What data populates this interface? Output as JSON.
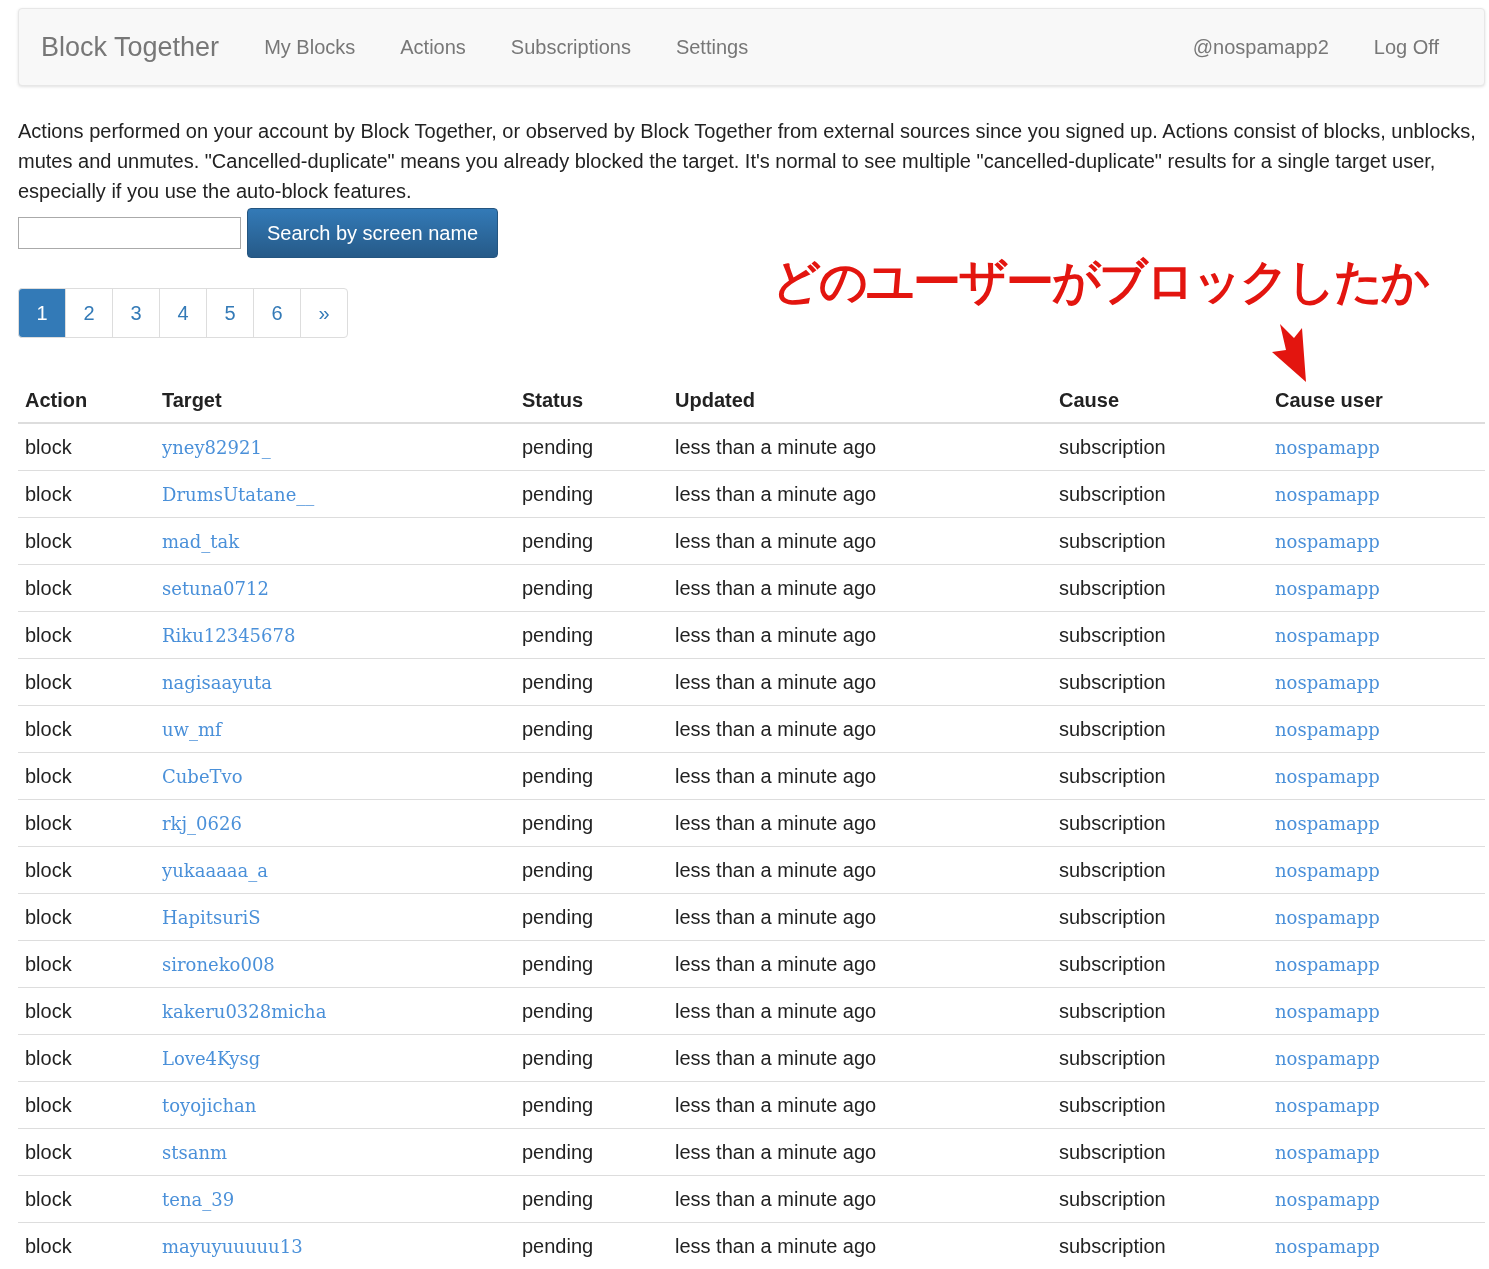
{
  "navbar": {
    "brand": "Block Together",
    "links": [
      "My Blocks",
      "Actions",
      "Subscriptions",
      "Settings"
    ],
    "right_links": [
      "@nospamapp2",
      "Log Off"
    ]
  },
  "intro": "Actions performed on your account by Block Together, or observed by Block Together from external sources since you signed up. Actions consist of blocks, unblocks, mutes and unmutes. \"Cancelled-duplicate\" means you already blocked the target. It's normal to see multiple \"cancelled-duplicate\" results for a single target user, especially if you use the auto-block features.",
  "search": {
    "button": "Search by screen name"
  },
  "pagination": [
    {
      "label": "1",
      "selected": true
    },
    {
      "label": "2",
      "selected": false
    },
    {
      "label": "3",
      "selected": false
    },
    {
      "label": "4",
      "selected": false
    },
    {
      "label": "5",
      "selected": false
    },
    {
      "label": "6",
      "selected": false
    },
    {
      "label": "»",
      "selected": false
    }
  ],
  "annotation": "どのユーザーがブロックしたか",
  "table": {
    "columns": [
      "Action",
      "Target",
      "Status",
      "Updated",
      "Cause",
      "Cause user"
    ],
    "rows": [
      [
        "block",
        "yney82921_",
        "pending",
        "less than a minute ago",
        "subscription",
        "nospamapp"
      ],
      [
        "block",
        "DrumsUtatane__",
        "pending",
        "less than a minute ago",
        "subscription",
        "nospamapp"
      ],
      [
        "block",
        "mad_tak",
        "pending",
        "less than a minute ago",
        "subscription",
        "nospamapp"
      ],
      [
        "block",
        "setuna0712",
        "pending",
        "less than a minute ago",
        "subscription",
        "nospamapp"
      ],
      [
        "block",
        "Riku12345678",
        "pending",
        "less than a minute ago",
        "subscription",
        "nospamapp"
      ],
      [
        "block",
        "nagisaayuta",
        "pending",
        "less than a minute ago",
        "subscription",
        "nospamapp"
      ],
      [
        "block",
        "uw_mf",
        "pending",
        "less than a minute ago",
        "subscription",
        "nospamapp"
      ],
      [
        "block",
        "CubeTvo",
        "pending",
        "less than a minute ago",
        "subscription",
        "nospamapp"
      ],
      [
        "block",
        "rkj_0626",
        "pending",
        "less than a minute ago",
        "subscription",
        "nospamapp"
      ],
      [
        "block",
        "yukaaaaa_a",
        "pending",
        "less than a minute ago",
        "subscription",
        "nospamapp"
      ],
      [
        "block",
        "HapitsuriS",
        "pending",
        "less than a minute ago",
        "subscription",
        "nospamapp"
      ],
      [
        "block",
        "sironeko008",
        "pending",
        "less than a minute ago",
        "subscription",
        "nospamapp"
      ],
      [
        "block",
        "kakeru0328micha",
        "pending",
        "less than a minute ago",
        "subscription",
        "nospamapp"
      ],
      [
        "block",
        "Love4Kysg",
        "pending",
        "less than a minute ago",
        "subscription",
        "nospamapp"
      ],
      [
        "block",
        "toyojichan",
        "pending",
        "less than a minute ago",
        "subscription",
        "nospamapp"
      ],
      [
        "block",
        "stsanm",
        "pending",
        "less than a minute ago",
        "subscription",
        "nospamapp"
      ],
      [
        "block",
        "tena_39",
        "pending",
        "less than a minute ago",
        "subscription",
        "nospamapp"
      ],
      [
        "block",
        "mayuyuuuuu13",
        "pending",
        "less than a minute ago",
        "subscription",
        "nospamapp"
      ]
    ]
  }
}
